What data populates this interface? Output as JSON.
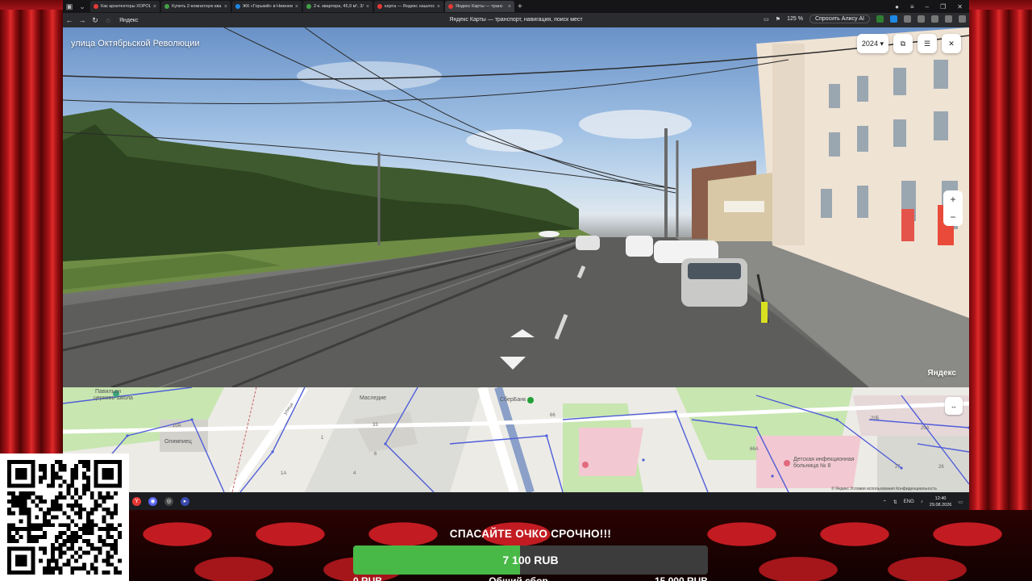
{
  "browser": {
    "tabs": [
      {
        "label": "Как архитекторы ХОРОШ",
        "color": "#e53935"
      },
      {
        "label": "Купить 2-комнатную ква",
        "color": "#43a047"
      },
      {
        "label": "ЖК «Горький» в Нижнем",
        "color": "#1e88e5"
      },
      {
        "label": "2-к. квартира, 45,9 м², 3/",
        "color": "#43a047"
      },
      {
        "label": "карта — Яндекс нашлось",
        "color": "#e53935"
      },
      {
        "label": "Яндекс Карты — транс",
        "color": "#e53935",
        "active": true
      }
    ],
    "site": "Яндекс",
    "page_title": "Яндекс Карты — транспорт, навигация, поиск мест",
    "zoom": "125 %",
    "alice": "Спросить Алису AI"
  },
  "panorama": {
    "street_name": "улица Октябрьской Революции",
    "year": "2024",
    "brand": "Яндекс",
    "zoom_in": "+",
    "zoom_out": "−"
  },
  "map": {
    "labels": {
      "pavilion": "Павильон",
      "school": "церковь-школа",
      "olimpiets": "Олимпиец",
      "masledie": "Маследие",
      "sberbank": "СберБанк",
      "street": "улица",
      "hospital": "Детская инфекционная больница № 8",
      "n10a": "10А",
      "n33": "33",
      "n66": "66",
      "n20b": "20Б",
      "n20a": "20А",
      "n66a": "66А",
      "n27": "27",
      "n26": "26",
      "n1a": "1А",
      "n4": "4",
      "n6": "6",
      "n1": "1"
    },
    "footer": "© Яндекс  Условия использования  Конфиденциальность"
  },
  "taskbar": {
    "lang": "ENG",
    "time": "12:40",
    "date": "29.08.2026"
  },
  "stream": {
    "donate_title": "СПАСАЙТЕ ОЧКО СРОЧНО!!!",
    "donate_amount": "7 100 RUB",
    "progress_fraction": 0.47,
    "below_left": "0 RUB",
    "below_mid": "Общий сбор",
    "below_right": "15 000 RUB"
  }
}
